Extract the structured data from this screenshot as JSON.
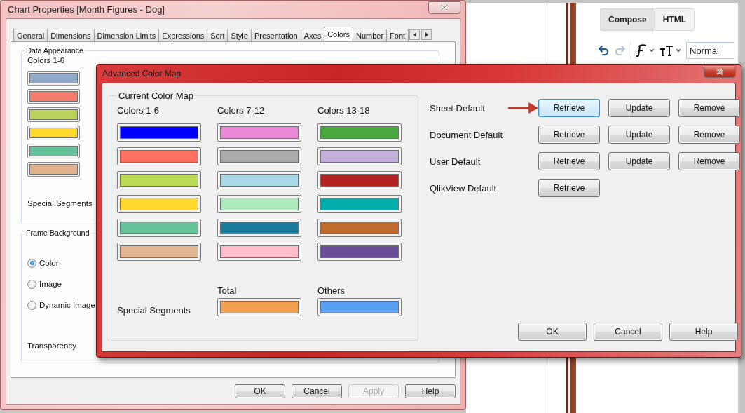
{
  "chart_properties": {
    "title": "Chart Properties [Month Figures - Dog]",
    "tabs": [
      {
        "label": "General",
        "selected": false
      },
      {
        "label": "Dimensions",
        "selected": false
      },
      {
        "label": "Dimension Limits",
        "selected": false
      },
      {
        "label": "Expressions",
        "selected": false
      },
      {
        "label": "Sort",
        "selected": false
      },
      {
        "label": "Style",
        "selected": false
      },
      {
        "label": "Presentation",
        "selected": false
      },
      {
        "label": "Axes",
        "selected": false
      },
      {
        "label": "Colors",
        "selected": true
      },
      {
        "label": "Number",
        "selected": false
      },
      {
        "label": "Font",
        "selected": false
      }
    ],
    "data_appearance": {
      "title": "Data Appearance",
      "column_label": "Colors 1-6",
      "swatches": [
        {
          "color": "#8eaacb"
        },
        {
          "color": "#f47c6c"
        },
        {
          "color": "#b7d35a"
        },
        {
          "color": "#ffd82e"
        },
        {
          "color": "#66c29a"
        },
        {
          "color": "#e2b08d"
        }
      ],
      "special_segments": "Special Segments"
    },
    "frame_background": {
      "title": "Frame Background",
      "options": [
        {
          "label": "Color",
          "selected": true
        },
        {
          "label": "Image",
          "selected": false
        },
        {
          "label": "Dynamic Image",
          "selected": false
        }
      ],
      "transparency": "Transparency"
    },
    "buttons": [
      {
        "label": "OK",
        "disabled": false
      },
      {
        "label": "Cancel",
        "disabled": false
      },
      {
        "label": "Apply",
        "disabled": true
      },
      {
        "label": "Help",
        "disabled": false
      }
    ]
  },
  "editor": {
    "tabs": [
      {
        "label": "Compose",
        "selected": true
      },
      {
        "label": "HTML",
        "selected": false
      }
    ],
    "format_field": {
      "value": "Normal"
    }
  },
  "advanced_color_map": {
    "title": "Advanced Color Map",
    "group_title": "Current Color Map",
    "columns": [
      {
        "label": "Colors 1-6",
        "swatches": [
          {
            "color": "#0000ff"
          },
          {
            "color": "#ff7060"
          },
          {
            "color": "#bada55"
          },
          {
            "color": "#ffd92e"
          },
          {
            "color": "#66c29a"
          },
          {
            "color": "#e3b693"
          }
        ]
      },
      {
        "label": "Colors 7-12",
        "swatches": [
          {
            "color": "#e88ad6"
          },
          {
            "color": "#aaaaaa"
          },
          {
            "color": "#a9d8e6"
          },
          {
            "color": "#ace9bb"
          },
          {
            "color": "#1c7a9a"
          },
          {
            "color": "#ffbdc9"
          }
        ]
      },
      {
        "label": "Colors 13-18",
        "swatches": [
          {
            "color": "#48a83e"
          },
          {
            "color": "#c3b1dc"
          },
          {
            "color": "#b22222"
          },
          {
            "color": "#00aeae"
          },
          {
            "color": "#c06a2c"
          },
          {
            "color": "#6b4e9a"
          }
        ]
      }
    ],
    "special_segments": {
      "label": "Special Segments",
      "items": [
        {
          "label": "Total",
          "color": "#f0a050"
        },
        {
          "label": "Others",
          "color": "#5aa0f0"
        }
      ]
    },
    "defaults": [
      {
        "label": "Sheet Default",
        "pointer": true,
        "buttons": [
          {
            "label": "Retrieve",
            "focused": true
          },
          {
            "label": "Update",
            "focused": false
          },
          {
            "label": "Remove",
            "focused": false
          }
        ]
      },
      {
        "label": "Document Default",
        "pointer": false,
        "buttons": [
          {
            "label": "Retrieve",
            "focused": false
          },
          {
            "label": "Update",
            "focused": false
          },
          {
            "label": "Remove",
            "focused": false
          }
        ]
      },
      {
        "label": "User Default",
        "pointer": false,
        "buttons": [
          {
            "label": "Retrieve",
            "focused": false
          },
          {
            "label": "Update",
            "focused": false
          },
          {
            "label": "Remove",
            "focused": false
          }
        ]
      },
      {
        "label": "QlikView Default",
        "pointer": false,
        "buttons": [
          {
            "label": "Retrieve",
            "focused": false
          }
        ]
      }
    ],
    "buttons": [
      {
        "label": "OK"
      },
      {
        "label": "Cancel"
      },
      {
        "label": "Help"
      }
    ]
  }
}
